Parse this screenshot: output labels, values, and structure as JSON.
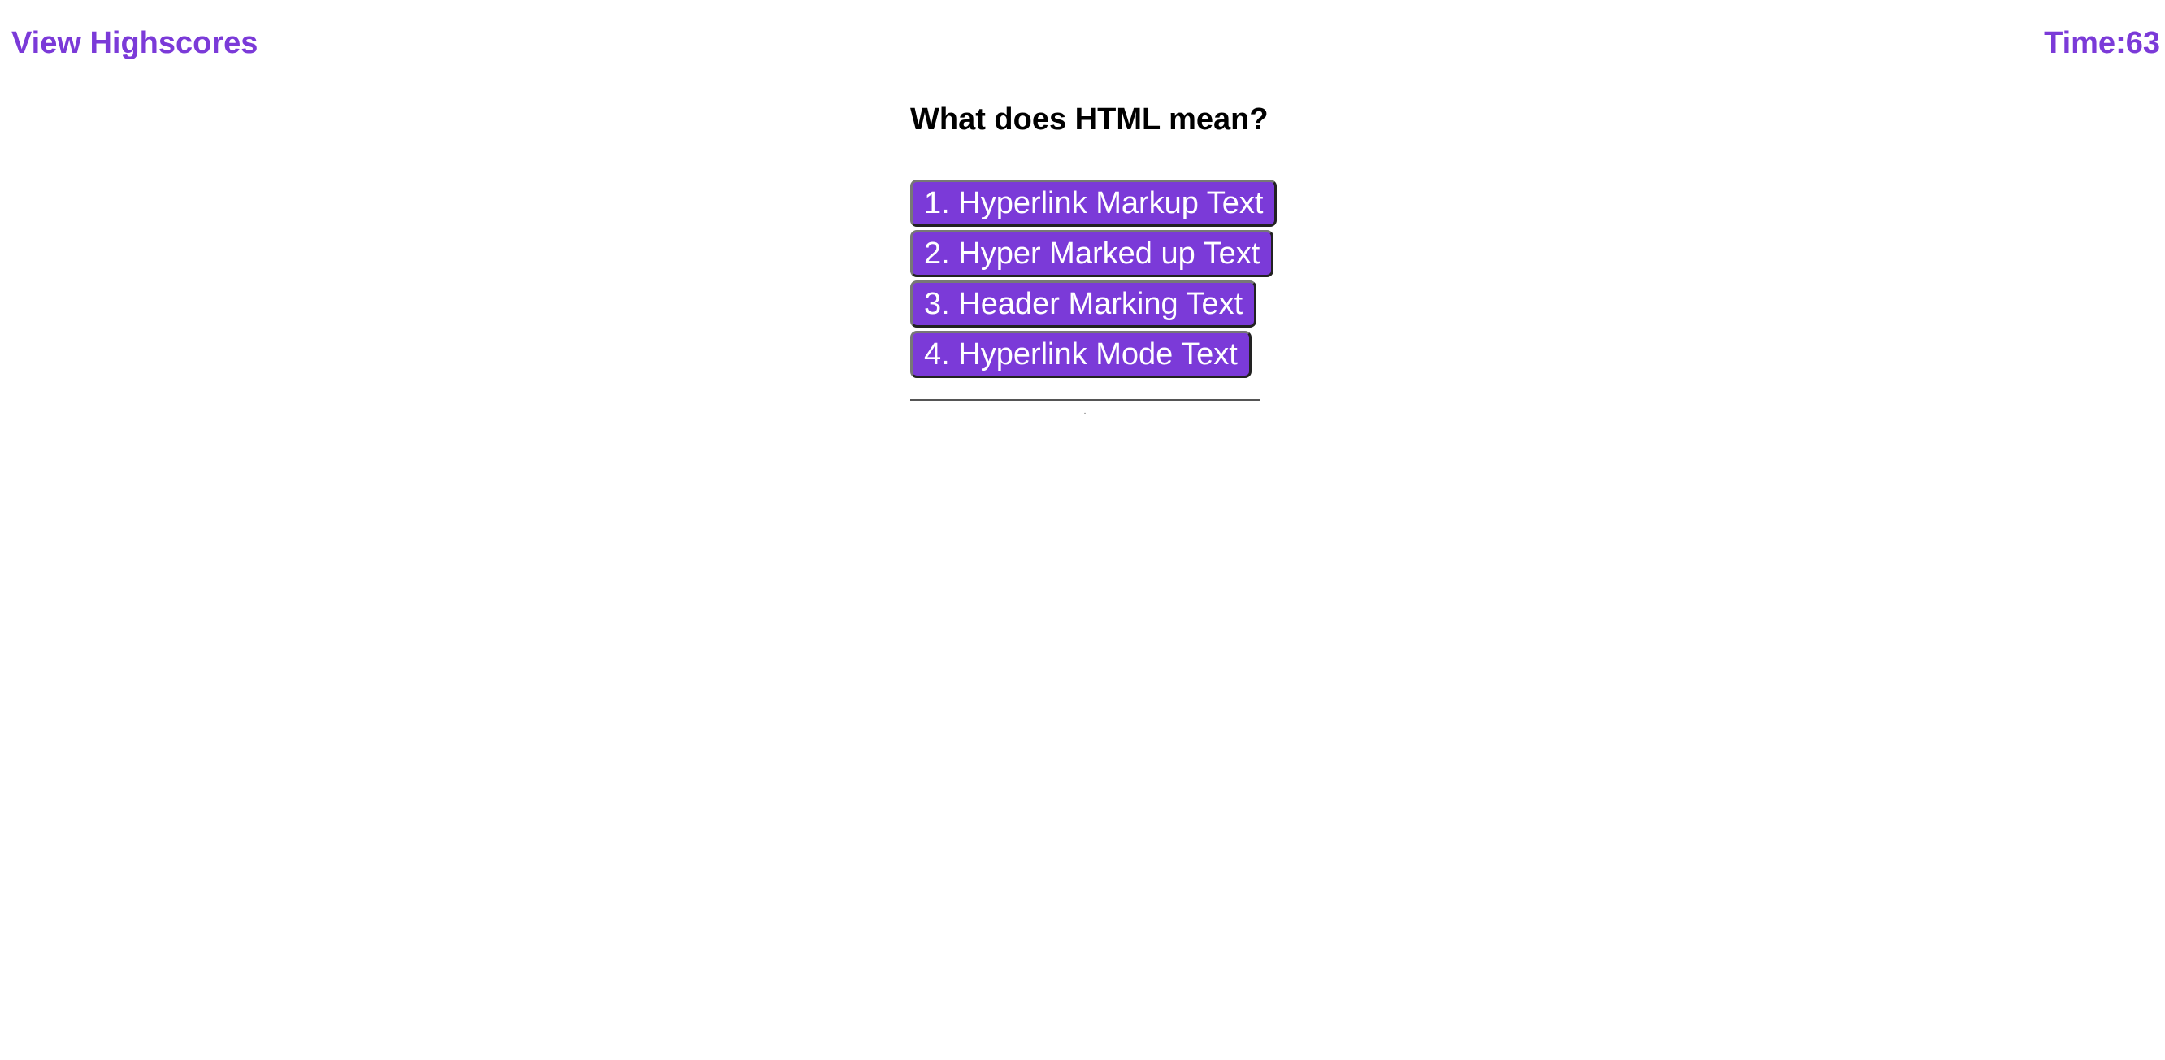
{
  "header": {
    "highscores_label": "View Highscores",
    "timer_text": "Time:63",
    "accent_color": "#7b3ad8"
  },
  "quiz": {
    "question": "What does HTML mean?",
    "choices": [
      {
        "label": "1. Hyperlink Markup Text"
      },
      {
        "label": "2. Hyper Marked up Text"
      },
      {
        "label": "3. Header Marking Text"
      },
      {
        "label": "4. Hyperlink Mode Text"
      }
    ],
    "feedback": "."
  }
}
